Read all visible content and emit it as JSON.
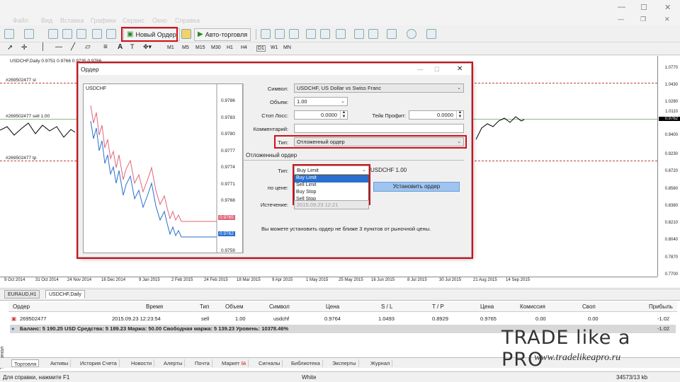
{
  "menu": {
    "items": [
      "Файл",
      "Вид",
      "Вставка",
      "Графики",
      "Сервис",
      "Окно",
      "Справка"
    ]
  },
  "toolbar": {
    "new_order_label": "Новый Ордер",
    "auto_trading_label": "Авто-торговля",
    "timeframes": [
      "M1",
      "M5",
      "M15",
      "M30",
      "H1",
      "H4",
      "D1",
      "W1",
      "MN"
    ]
  },
  "chart": {
    "header": "USDCHF,Daily  0.9751 0.9766 0.9735 0.9766",
    "line_sl_label": "#269502477 sl",
    "line_sell_label": "#269502477 sell 1.00",
    "line_tp_label": "#269502477 tp",
    "price_labels": [
      "1.0770",
      "1.0430",
      "1.0280",
      "1.0110",
      "0.9762",
      "0.9400",
      "0.9230",
      "0.8720",
      "0.8560",
      "0.8380",
      "0.8210",
      "0.8040",
      "0.7870",
      "0.7700"
    ],
    "current_price": "0.9762",
    "date_labels": [
      "9 Oct 2014",
      "31 Oct 2014",
      "24 Nov 2014",
      "16 Dec 2014",
      "9 Jan 2015",
      "2 Feb 2015",
      "24 Feb 2015",
      "18 Mar 2015",
      "9 Apr 2015",
      "1 May 2015",
      "25 May 2015",
      "16 Jun 2015",
      "8 Jul 2015",
      "30 Jul 2015",
      "21 Aug 2015",
      "14 Sep 2015"
    ]
  },
  "chart_tabs": [
    "EURAUD,H1",
    "USDCHF,Daily"
  ],
  "dialog": {
    "title": "Ордер",
    "mini_chart_symbol": "USDCHF",
    "mini_prices": [
      "0.9786",
      "0.9783",
      "0.9780",
      "0.9777",
      "0.9774",
      "0.9771",
      "0.9768",
      "0.9765",
      "0.9762",
      "0.9759"
    ],
    "mini_ask": "0.9765",
    "mini_bid": "0.9762",
    "symbol_label": "Символ:",
    "symbol_value": "USDCHF, US Dollar vs Swiss Franc",
    "volume_label": "Объем:",
    "volume_value": "1.00",
    "sl_label": "Стоп Лосс:",
    "sl_value": "0.0000",
    "tp_label": "Тейк Профит:",
    "tp_value": "0.0000",
    "comment_label": "Комментарий:",
    "type_label": "Тип:",
    "type_value": "Отложенный ордер",
    "pending_section": "Отложенный ордер",
    "pending_type_label": "Тип:",
    "pending_type_value": "Buy Limit",
    "pending_type_options": [
      "Buy Limit",
      "Sell Limit",
      "Buy Stop",
      "Sell Stop"
    ],
    "pending_symbol_info": "USDCHF 1.00",
    "price_label": "по цене:",
    "expiry_label": "Истечение:",
    "expiry_value": "2015.09.23 12:21",
    "place_button": "Установить ордер",
    "note": "Вы можете установить ордер не ближе 3 пунктов от рыночной цены."
  },
  "terminal": {
    "headers": [
      "Ордер",
      "Время",
      "Тип",
      "Объем",
      "Символ",
      "Цена",
      "S / L",
      "T / P",
      "Цена",
      "Комиссия",
      "Своп",
      "Прибыль"
    ],
    "rows": [
      [
        "269502477",
        "2015.09.23 12:23:54",
        "sell",
        "1.00",
        "usdchf",
        "0.9764",
        "1.0493",
        "0.8929",
        "0.9765",
        "0.00",
        "0.00",
        "-1.02"
      ]
    ],
    "balance_line": "Баланс: 5 190.25 USD  Средства: 5 189.23  Маржа: 50.00  Свободная маржа: 5 139.23  Уровень: 10378.46%",
    "balance_profit": "-1.02",
    "side_label": "Терминал",
    "tabs": [
      "Торговля",
      "Активы",
      "История Счета",
      "Новости",
      "Алерты",
      "Почта",
      "Маркет",
      "Сигналы",
      "Библиотека",
      "Эксперты",
      "Журнал"
    ],
    "market_badge": "56"
  },
  "status": {
    "help": "Для справки, нажмите F1",
    "profile": "White",
    "traffic": "34573/13 kb"
  },
  "watermark": {
    "title": "TRADE like a PRO",
    "url": "www.tradelikeapro.ru"
  },
  "colors": {
    "accent_red": "#d0101a",
    "ask": "#e0657a",
    "bid": "#2a6fd0",
    "chart_line": "#000000"
  }
}
